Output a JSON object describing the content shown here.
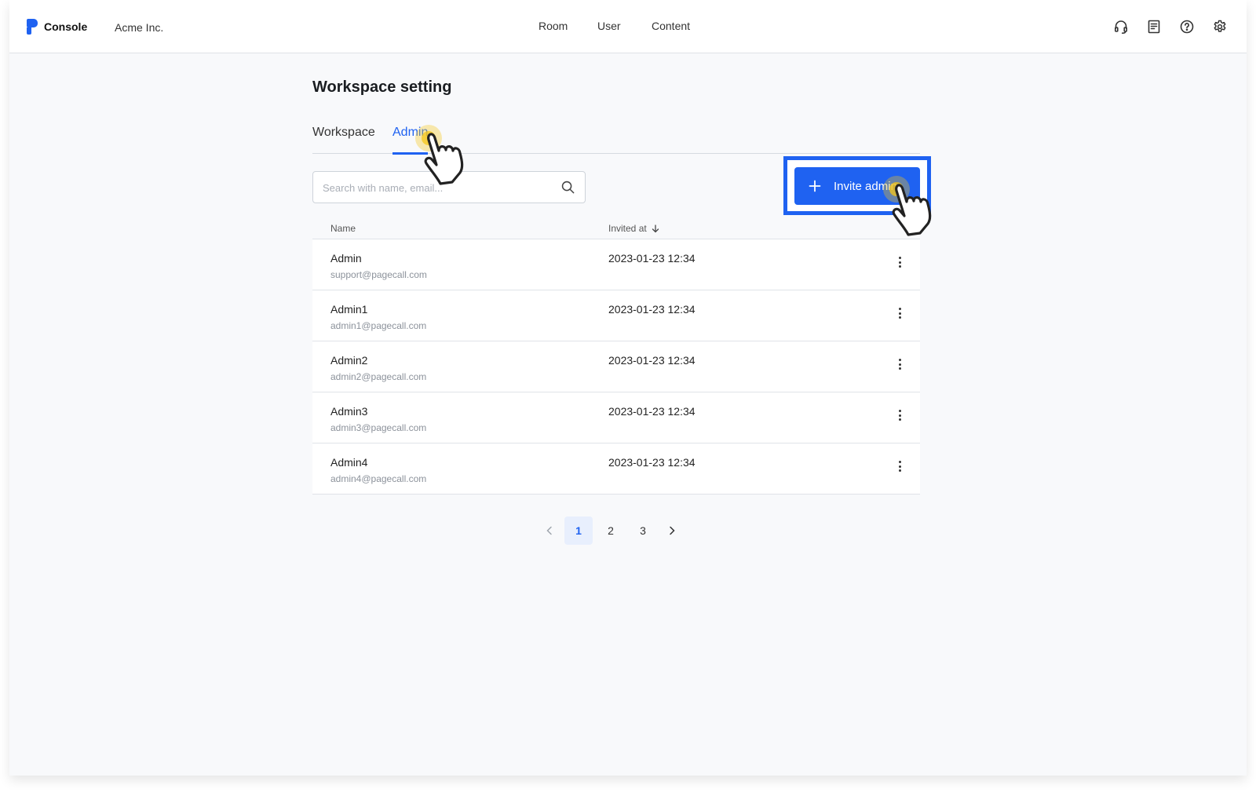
{
  "header": {
    "brand_label": "Console",
    "org_name": "Acme Inc.",
    "nav": [
      "Room",
      "User",
      "Content"
    ],
    "icons": [
      "headset-icon",
      "document-icon",
      "help-icon",
      "settings-icon"
    ]
  },
  "page": {
    "title": "Workspace setting",
    "tabs": [
      {
        "label": "Workspace",
        "active": false
      },
      {
        "label": "Admin",
        "active": true
      }
    ]
  },
  "search": {
    "placeholder": "Search with name, email...",
    "value": ""
  },
  "invite_button": {
    "label": "Invite admin"
  },
  "table": {
    "columns": {
      "name": "Name",
      "invited_at": "Invited at",
      "sort_direction": "descending"
    },
    "rows": [
      {
        "name": "Admin",
        "email": "support@pagecall.com",
        "invited_at": "2023-01-23 12:34"
      },
      {
        "name": "Admin1",
        "email": "admin1@pagecall.com",
        "invited_at": "2023-01-23 12:34"
      },
      {
        "name": "Admin2",
        "email": "admin2@pagecall.com",
        "invited_at": "2023-01-23 12:34"
      },
      {
        "name": "Admin3",
        "email": "admin3@pagecall.com",
        "invited_at": "2023-01-23 12:34"
      },
      {
        "name": "Admin4",
        "email": "admin4@pagecall.com",
        "invited_at": "2023-01-23 12:34"
      }
    ]
  },
  "pagination": {
    "pages": [
      "1",
      "2",
      "3"
    ],
    "current": "1"
  },
  "colors": {
    "accent": "#1f62f1",
    "highlight": "#f5c518"
  }
}
